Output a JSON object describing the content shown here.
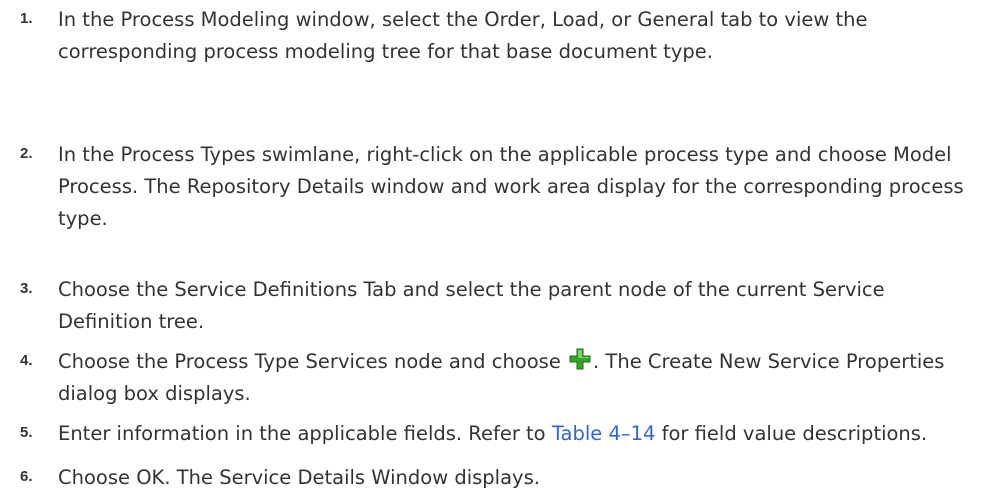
{
  "steps": [
    {
      "number": "1.",
      "text": "In the Process Modeling window, select the Order, Load, or General tab to view the corresponding process modeling tree for that base document type."
    },
    {
      "number": "2.",
      "text": "In the Process Types swimlane, right-click on the applicable process type and choose Model Process. The Repository Details window and work area display for the corresponding process type."
    },
    {
      "number": "3.",
      "text": "Choose the Service Definitions Tab and select the parent node of the current Service Definition tree."
    },
    {
      "number": "4.",
      "text_before": "Choose the Process Type Services node and choose",
      "icon": "green-plus-icon",
      "text_after": ". The Create New Service Properties dialog box displays."
    },
    {
      "number": "5.",
      "text_before": "Enter information in the applicable fields. Refer to",
      "link": "Table 4–14",
      "text_after": "for field value descriptions."
    },
    {
      "number": "6.",
      "text": "Choose OK. The Service Details Window displays."
    }
  ],
  "colors": {
    "text": "#333333",
    "link": "#3366cc",
    "icon_green": "#33a329"
  }
}
